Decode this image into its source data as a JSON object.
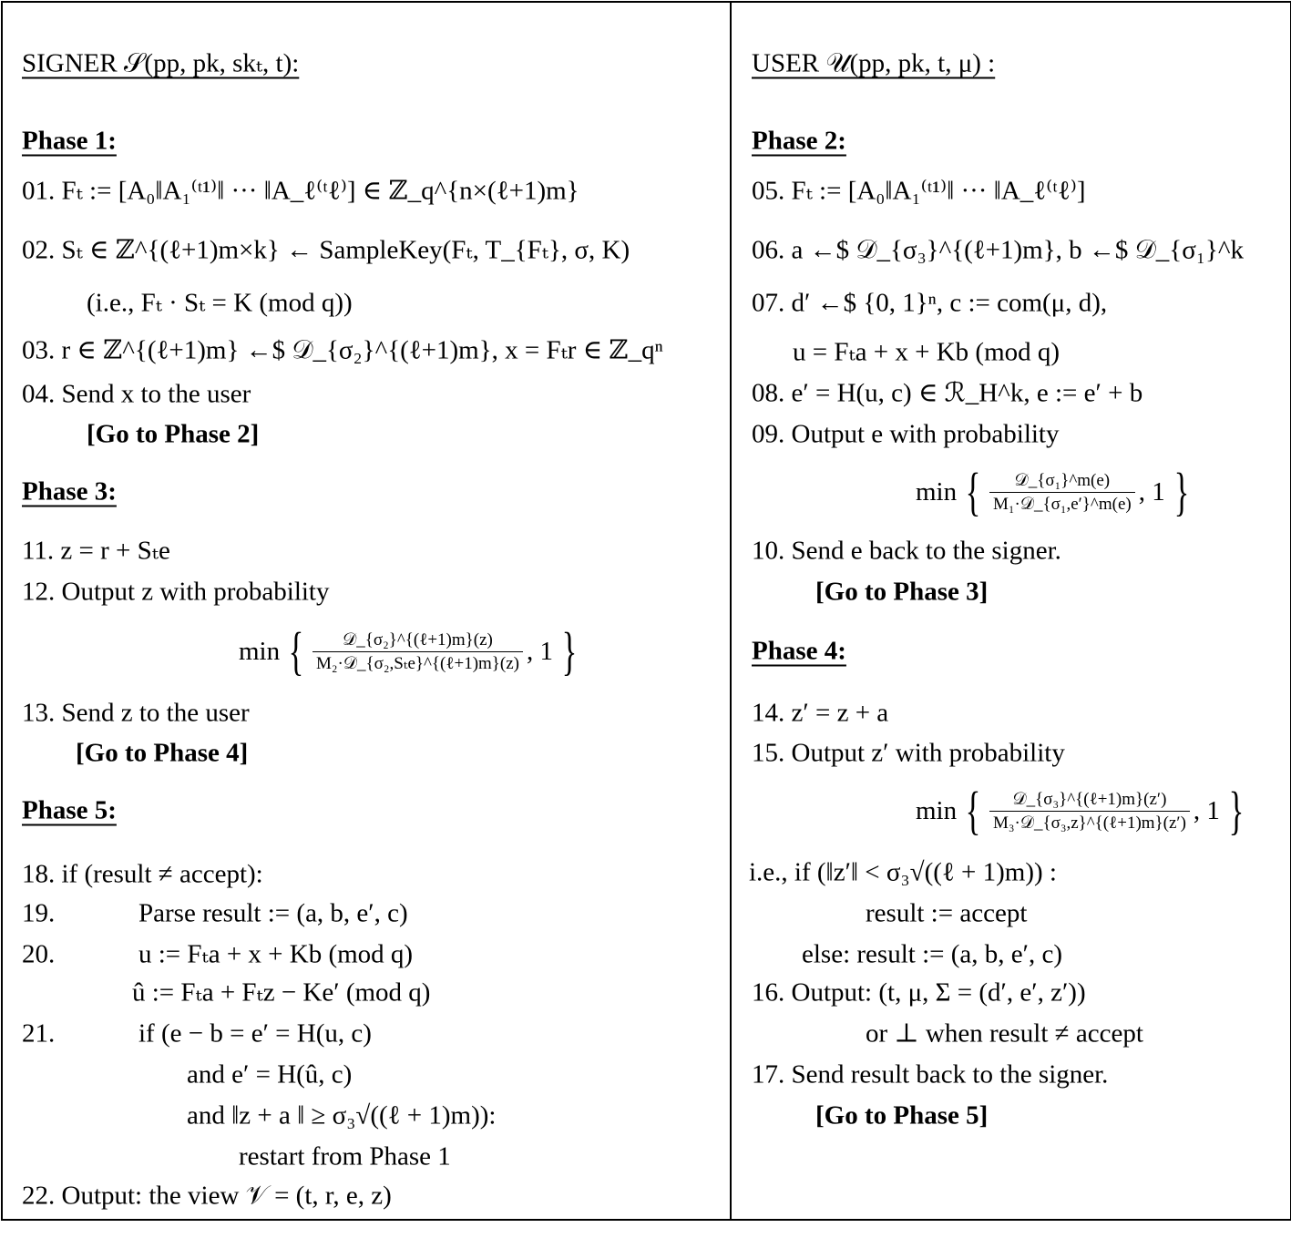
{
  "signer": {
    "header": "SIGNER 𝒮(pp, pk, skₜ, t):",
    "phase1": "Phase 1:",
    "l01": "01. Fₜ := [A₀‖A₁⁽ᵗ¹⁾‖ ··· ‖A_ℓ⁽ᵗℓ⁾] ∈ ℤ_q^{n×(ℓ+1)m}",
    "l02": "02. Sₜ ∈ ℤ^{(ℓ+1)m×k} ← SampleKey(Fₜ, T_{Fₜ}, σ, K)",
    "l02b": "(i.e., Fₜ · Sₜ = K  (mod q))",
    "l03": "03. r ∈ ℤ^{(ℓ+1)m} ←$ 𝒟_{σ₂}^{(ℓ+1)m},  x = Fₜr ∈ ℤ_qⁿ",
    "l04": "04. Send x to the user",
    "go2": "[Go to Phase 2]",
    "phase3": "Phase 3:",
    "l11": "11. z = r + Sₜe",
    "l12": "12. Output z with probability",
    "min12": {
      "min": "min",
      "num": "𝒟_{σ₂}^{(ℓ+1)m}(z)",
      "den": "M₂·𝒟_{σ₂,Sₜe}^{(ℓ+1)m}(z)",
      "one": ", 1"
    },
    "l13": "13. Send z to the user",
    "go4": "[Go to Phase 4]",
    "phase5": "Phase 5:",
    "l18": "18. if (result ≠ accept):",
    "l19n": "19.",
    "l19": "Parse result := (a, b, e′, c)",
    "l20n": "20.",
    "l20": "u := Fₜa + x + Kb  (mod q)",
    "l20b": "û := Fₜa + Fₜz − Ke′  (mod q)",
    "l21n": "21.",
    "l21": "if (e − b = e′ = H(u, c)",
    "l21b": "and e′ = H(û, c)",
    "l21c": "and ‖z + a ‖ ≥ σ₃√((ℓ + 1)m)):",
    "l21d": "restart from Phase 1",
    "l22": "22. Output: the view 𝒱 = (t, r, e, z)"
  },
  "user": {
    "header": "USER 𝒰(pp, pk, t, μ) :",
    "phase2": "Phase 2:",
    "l05": "05. Fₜ := [A₀‖A₁⁽ᵗ¹⁾‖ ··· ‖A_ℓ⁽ᵗℓ⁾]",
    "l06": "06. a ←$ 𝒟_{σ₃}^{(ℓ+1)m},  b ←$ 𝒟_{σ₁}^k",
    "l07": "07. d′ ←$ {0, 1}ⁿ,  c := com(μ, d),",
    "l07b": "u = Fₜa + x + Kb  (mod q)",
    "l08": "08. e′ = H(u, c) ∈ ℛ_H^k,  e := e′ + b",
    "l09": "09. Output e with probability",
    "min09": {
      "min": "min",
      "num": "𝒟_{σ₁}^m(e)",
      "den": "M₁·𝒟_{σ₁,e′}^m(e)",
      "one": ", 1"
    },
    "l10": "10. Send e back to the signer.",
    "go3": "[Go to Phase 3]",
    "phase4": "Phase 4:",
    "l14": "14. z′ = z + a",
    "l15": "15. Output z′ with probability",
    "min15": {
      "min": "min",
      "num": "𝒟_{σ₃}^{(ℓ+1)m}(z′)",
      "den": "M₃·𝒟_{σ₃,z}^{(ℓ+1)m}(z′)",
      "one": ", 1"
    },
    "l15b": "i.e., if  (‖z′‖ < σ₃√((ℓ + 1)m)) :",
    "l15c": "result := accept",
    "l15d": "else: result := (a, b, e′, c)",
    "l16": "16. Output: (t, μ, Σ = (d′, e′, z′))",
    "l16b": "or ⊥ when result ≠ accept",
    "l17": "17. Send  result  back to the signer.",
    "go5": "[Go to Phase 5]"
  }
}
